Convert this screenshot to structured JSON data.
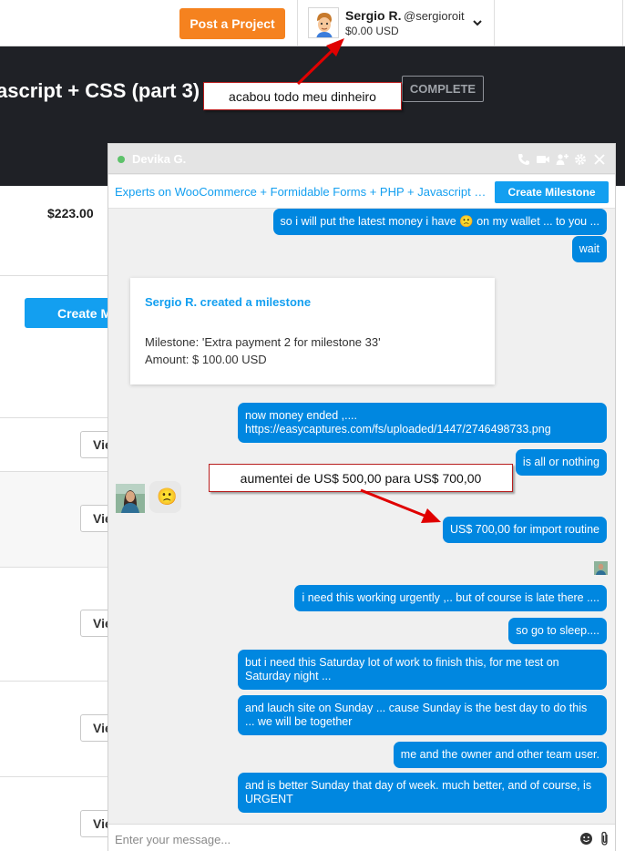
{
  "header": {
    "post_project_label": "Post a Project",
    "user_name": "Sergio R.",
    "user_handle": "@sergioroit",
    "user_balance": "$0.00 USD"
  },
  "project": {
    "title_fragment": "ascript + CSS (part 3)",
    "status": "COMPLETE"
  },
  "background": {
    "price": "$223.00",
    "create_milestone_fragment": "Create M",
    "view_fragment": "Vie"
  },
  "chat": {
    "contact_name": "Devika G.",
    "project_title": "Experts on WooCommerce + Formidable Forms + PHP + Javascript + CSS (part 3)",
    "create_milestone_label": "Create Milestone",
    "input_placeholder": "Enter your message...",
    "milestone_card": {
      "title": "Sergio R. created a milestone",
      "description": "Milestone: 'Extra payment 2 for milestone 33'",
      "amount": "Amount: $ 100.00 USD"
    },
    "messages": [
      {
        "text": "so i will put the latest money i have 🙁 on my wallet ... to you ..."
      },
      {
        "text": "wait"
      },
      {
        "text": "now money ended ,....\nhttps://easycaptures.com/fs/uploaded/1447/2746498733.png"
      },
      {
        "text": "is all or nothing"
      },
      {
        "text": "US$ 700,00 for import routine"
      },
      {
        "text": "i need this working urgently ,.. but of course is late there ...."
      },
      {
        "text": "so go to sleep...."
      },
      {
        "text": "but i need this Saturday lot of work to finish this, for me test on Saturday night ..."
      },
      {
        "text": "and lauch site on Sunday ... cause Sunday is the best day to do this ... we will be together"
      },
      {
        "text": "me and the owner and other team user."
      },
      {
        "text": "and is better Sunday that day of week. much better, and of course, is URGENT"
      }
    ],
    "incoming_reaction": "🙁"
  },
  "annotations": {
    "note_1": "acabou todo meu dinheiro",
    "note_2": "aumentei de US$ 500,00 para US$ 700,00"
  },
  "colors": {
    "accent_orange": "#f5821f",
    "accent_blue": "#139ff0",
    "bubble_blue": "#0087e0",
    "header_dark": "#1f2126",
    "annotation_red": "#e00000"
  }
}
